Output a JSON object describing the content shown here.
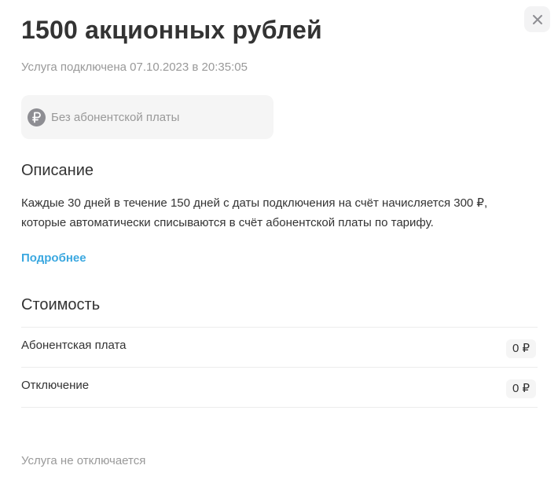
{
  "header": {
    "title": "1500 акционных рублей",
    "subtitle": "Услуга подключена 07.10.2023 в 20:35:05",
    "close_icon": "close-icon"
  },
  "fee_card": {
    "icon": "ruble-icon",
    "label": "Без абонентской платы"
  },
  "description": {
    "heading": "Описание",
    "text": "Каждые 30 дней в течение 150 дней с даты подключения на счёт начисляется 300 ₽, которые автоматически списываются в счёт абонентской платы по тарифу.",
    "more_link": "Подробнее"
  },
  "cost": {
    "heading": "Стоимость",
    "rows": [
      {
        "name": "Абонентская плата",
        "value": "0 ₽"
      },
      {
        "name": "Отключение",
        "value": "0 ₽"
      }
    ]
  },
  "footer": {
    "note": "Услуга не отключается"
  },
  "colors": {
    "link": "#3ba8e0",
    "muted_text": "#999999",
    "text": "#333333",
    "card_bg": "#f5f5f5"
  }
}
